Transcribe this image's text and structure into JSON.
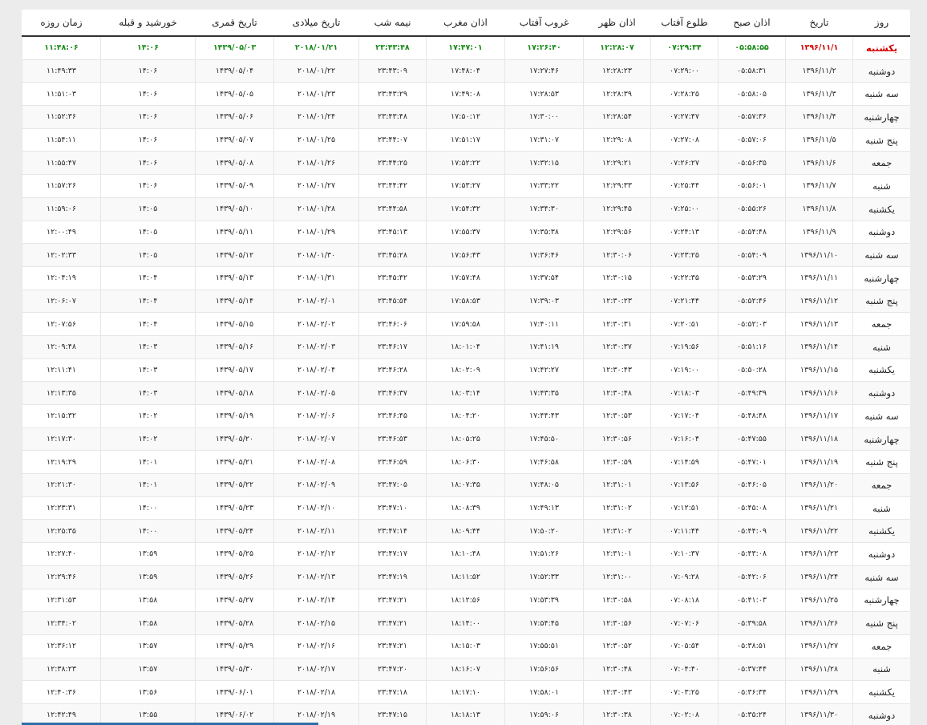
{
  "colors": {
    "today_green": "#1a8a1a",
    "today_red": "#d60000",
    "header_rule": "#333333",
    "scrollbar": "#2e6ea6"
  },
  "table": {
    "columns": [
      {
        "key": "day",
        "label": "روز"
      },
      {
        "key": "date",
        "label": "تاریخ"
      },
      {
        "key": "fajr",
        "label": "اذان صبح"
      },
      {
        "key": "sunrise",
        "label": "طلوع آفتاب"
      },
      {
        "key": "dhuhr",
        "label": "اذان ظهر"
      },
      {
        "key": "sunset",
        "label": "غروب آفتاب"
      },
      {
        "key": "maghrib",
        "label": "اذان مغرب"
      },
      {
        "key": "midnight",
        "label": "نیمه شب"
      },
      {
        "key": "gregorian",
        "label": "تاریخ میلادی"
      },
      {
        "key": "hijri",
        "label": "تاریخ قمری"
      },
      {
        "key": "qibla",
        "label": "خورشید و قبله"
      },
      {
        "key": "fast",
        "label": "زمان روزه"
      }
    ],
    "today_index": 0,
    "rows": [
      [
        "یکشنبه",
        "۱۳۹۶/۱۱/۱",
        "۰۵:۵۸:۵۵",
        "۰۷:۲۹:۳۴",
        "۱۲:۲۸:۰۷",
        "۱۷:۲۶:۴۰",
        "۱۷:۴۷:۰۱",
        "۲۳:۴۳:۴۸",
        "۲۰۱۸/۰۱/۲۱",
        "۱۴۳۹/۰۵/۰۳",
        "۱۴:۰۶",
        "۱۱:۴۸:۰۶"
      ],
      [
        "دوشنبه",
        "۱۳۹۶/۱۱/۲",
        "۰۵:۵۸:۳۱",
        "۰۷:۲۹:۰۰",
        "۱۲:۲۸:۲۳",
        "۱۷:۲۷:۴۶",
        "۱۷:۴۸:۰۴",
        "۲۳:۴۳:۰۹",
        "۲۰۱۸/۰۱/۲۲",
        "۱۴۳۹/۰۵/۰۴",
        "۱۴:۰۶",
        "۱۱:۴۹:۳۳"
      ],
      [
        "سه شنبه",
        "۱۳۹۶/۱۱/۳",
        "۰۵:۵۸:۰۵",
        "۰۷:۲۸:۲۵",
        "۱۲:۲۸:۳۹",
        "۱۷:۲۸:۵۳",
        "۱۷:۴۹:۰۸",
        "۲۳:۴۳:۲۹",
        "۲۰۱۸/۰۱/۲۳",
        "۱۴۳۹/۰۵/۰۵",
        "۱۴:۰۶",
        "۱۱:۵۱:۰۳"
      ],
      [
        "چهارشنبه",
        "۱۳۹۶/۱۱/۴",
        "۰۵:۵۷:۳۶",
        "۰۷:۲۷:۴۷",
        "۱۲:۲۸:۵۴",
        "۱۷:۳۰:۰۰",
        "۱۷:۵۰:۱۲",
        "۲۳:۴۳:۴۸",
        "۲۰۱۸/۰۱/۲۴",
        "۱۴۳۹/۰۵/۰۶",
        "۱۴:۰۶",
        "۱۱:۵۲:۳۶"
      ],
      [
        "پنج شنبه",
        "۱۳۹۶/۱۱/۵",
        "۰۵:۵۷:۰۶",
        "۰۷:۲۷:۰۸",
        "۱۲:۲۹:۰۸",
        "۱۷:۳۱:۰۷",
        "۱۷:۵۱:۱۷",
        "۲۳:۴۴:۰۷",
        "۲۰۱۸/۰۱/۲۵",
        "۱۴۳۹/۰۵/۰۷",
        "۱۴:۰۶",
        "۱۱:۵۴:۱۱"
      ],
      [
        "جمعه",
        "۱۳۹۶/۱۱/۶",
        "۰۵:۵۶:۳۵",
        "۰۷:۲۶:۲۷",
        "۱۲:۲۹:۲۱",
        "۱۷:۳۲:۱۵",
        "۱۷:۵۲:۲۲",
        "۲۳:۴۴:۲۵",
        "۲۰۱۸/۰۱/۲۶",
        "۱۴۳۹/۰۵/۰۸",
        "۱۴:۰۶",
        "۱۱:۵۵:۴۷"
      ],
      [
        "شنبه",
        "۱۳۹۶/۱۱/۷",
        "۰۵:۵۶:۰۱",
        "۰۷:۲۵:۴۴",
        "۱۲:۲۹:۳۳",
        "۱۷:۳۳:۲۲",
        "۱۷:۵۳:۲۷",
        "۲۳:۴۴:۴۲",
        "۲۰۱۸/۰۱/۲۷",
        "۱۴۳۹/۰۵/۰۹",
        "۱۴:۰۶",
        "۱۱:۵۷:۲۶"
      ],
      [
        "یکشنبه",
        "۱۳۹۶/۱۱/۸",
        "۰۵:۵۵:۲۶",
        "۰۷:۲۵:۰۰",
        "۱۲:۲۹:۴۵",
        "۱۷:۳۴:۳۰",
        "۱۷:۵۴:۳۲",
        "۲۳:۴۴:۵۸",
        "۲۰۱۸/۰۱/۲۸",
        "۱۴۳۹/۰۵/۱۰",
        "۱۴:۰۵",
        "۱۱:۵۹:۰۶"
      ],
      [
        "دوشنبه",
        "۱۳۹۶/۱۱/۹",
        "۰۵:۵۴:۴۸",
        "۰۷:۲۴:۱۳",
        "۱۲:۲۹:۵۶",
        "۱۷:۳۵:۳۸",
        "۱۷:۵۵:۳۷",
        "۲۳:۴۵:۱۳",
        "۲۰۱۸/۰۱/۲۹",
        "۱۴۳۹/۰۵/۱۱",
        "۱۴:۰۵",
        "۱۲:۰۰:۴۹"
      ],
      [
        "سه شنبه",
        "۱۳۹۶/۱۱/۱۰",
        "۰۵:۵۴:۰۹",
        "۰۷:۲۳:۲۵",
        "۱۲:۳۰:۰۶",
        "۱۷:۳۶:۴۶",
        "۱۷:۵۶:۴۳",
        "۲۳:۴۵:۲۸",
        "۲۰۱۸/۰۱/۳۰",
        "۱۴۳۹/۰۵/۱۲",
        "۱۴:۰۵",
        "۱۲:۰۲:۳۳"
      ],
      [
        "چهارشنبه",
        "۱۳۹۶/۱۱/۱۱",
        "۰۵:۵۳:۲۹",
        "۰۷:۲۲:۳۵",
        "۱۲:۳۰:۱۵",
        "۱۷:۳۷:۵۴",
        "۱۷:۵۷:۴۸",
        "۲۳:۴۵:۴۲",
        "۲۰۱۸/۰۱/۳۱",
        "۱۴۳۹/۰۵/۱۳",
        "۱۴:۰۴",
        "۱۲:۰۴:۱۹"
      ],
      [
        "پنج شنبه",
        "۱۳۹۶/۱۱/۱۲",
        "۰۵:۵۲:۴۶",
        "۰۷:۲۱:۴۴",
        "۱۲:۳۰:۲۳",
        "۱۷:۳۹:۰۳",
        "۱۷:۵۸:۵۳",
        "۲۳:۴۵:۵۴",
        "۲۰۱۸/۰۲/۰۱",
        "۱۴۳۹/۰۵/۱۴",
        "۱۴:۰۴",
        "۱۲:۰۶:۰۷"
      ],
      [
        "جمعه",
        "۱۳۹۶/۱۱/۱۳",
        "۰۵:۵۲:۰۳",
        "۰۷:۲۰:۵۱",
        "۱۲:۳۰:۳۱",
        "۱۷:۴۰:۱۱",
        "۱۷:۵۹:۵۸",
        "۲۳:۴۶:۰۶",
        "۲۰۱۸/۰۲/۰۲",
        "۱۴۳۹/۰۵/۱۵",
        "۱۴:۰۴",
        "۱۲:۰۷:۵۶"
      ],
      [
        "شنبه",
        "۱۳۹۶/۱۱/۱۴",
        "۰۵:۵۱:۱۶",
        "۰۷:۱۹:۵۶",
        "۱۲:۳۰:۳۷",
        "۱۷:۴۱:۱۹",
        "۱۸:۰۱:۰۴",
        "۲۳:۴۶:۱۷",
        "۲۰۱۸/۰۲/۰۳",
        "۱۴۳۹/۰۵/۱۶",
        "۱۴:۰۳",
        "۱۲:۰۹:۴۸"
      ],
      [
        "یکشنبه",
        "۱۳۹۶/۱۱/۱۵",
        "۰۵:۵۰:۲۸",
        "۰۷:۱۹:۰۰",
        "۱۲:۳۰:۴۳",
        "۱۷:۴۲:۲۷",
        "۱۸:۰۲:۰۹",
        "۲۳:۴۶:۲۸",
        "۲۰۱۸/۰۲/۰۴",
        "۱۴۳۹/۰۵/۱۷",
        "۱۴:۰۳",
        "۱۲:۱۱:۴۱"
      ],
      [
        "دوشنبه",
        "۱۳۹۶/۱۱/۱۶",
        "۰۵:۴۹:۳۹",
        "۰۷:۱۸:۰۳",
        "۱۲:۳۰:۴۸",
        "۱۷:۴۳:۳۵",
        "۱۸:۰۳:۱۴",
        "۲۳:۴۶:۳۷",
        "۲۰۱۸/۰۲/۰۵",
        "۱۴۳۹/۰۵/۱۸",
        "۱۴:۰۳",
        "۱۲:۱۳:۳۵"
      ],
      [
        "سه شنبه",
        "۱۳۹۶/۱۱/۱۷",
        "۰۵:۴۸:۴۸",
        "۰۷:۱۷:۰۴",
        "۱۲:۳۰:۵۳",
        "۱۷:۴۴:۴۳",
        "۱۸:۰۴:۲۰",
        "۲۳:۴۶:۴۵",
        "۲۰۱۸/۰۲/۰۶",
        "۱۴۳۹/۰۵/۱۹",
        "۱۴:۰۲",
        "۱۲:۱۵:۳۲"
      ],
      [
        "چهارشنبه",
        "۱۳۹۶/۱۱/۱۸",
        "۰۵:۴۷:۵۵",
        "۰۷:۱۶:۰۴",
        "۱۲:۳۰:۵۶",
        "۱۷:۴۵:۵۰",
        "۱۸:۰۵:۲۵",
        "۲۳:۴۶:۵۳",
        "۲۰۱۸/۰۲/۰۷",
        "۱۴۳۹/۰۵/۲۰",
        "۱۴:۰۲",
        "۱۲:۱۷:۳۰"
      ],
      [
        "پنج شنبه",
        "۱۳۹۶/۱۱/۱۹",
        "۰۵:۴۷:۰۱",
        "۰۷:۱۴:۵۹",
        "۱۲:۳۰:۵۹",
        "۱۷:۴۶:۵۸",
        "۱۸:۰۶:۳۰",
        "۲۳:۴۶:۵۹",
        "۲۰۱۸/۰۲/۰۸",
        "۱۴۳۹/۰۵/۲۱",
        "۱۴:۰۱",
        "۱۲:۱۹:۲۹"
      ],
      [
        "جمعه",
        "۱۳۹۶/۱۱/۲۰",
        "۰۵:۴۶:۰۵",
        "۰۷:۱۳:۵۶",
        "۱۲:۳۱:۰۱",
        "۱۷:۴۸:۰۵",
        "۱۸:۰۷:۳۵",
        "۲۳:۴۷:۰۵",
        "۲۰۱۸/۰۲/۰۹",
        "۱۴۳۹/۰۵/۲۲",
        "۱۴:۰۱",
        "۱۲:۲۱:۳۰"
      ],
      [
        "شنبه",
        "۱۳۹۶/۱۱/۲۱",
        "۰۵:۴۵:۰۸",
        "۰۷:۱۲:۵۱",
        "۱۲:۳۱:۰۲",
        "۱۷:۴۹:۱۳",
        "۱۸:۰۸:۳۹",
        "۲۳:۴۷:۱۰",
        "۲۰۱۸/۰۲/۱۰",
        "۱۴۳۹/۰۵/۲۳",
        "۱۴:۰۰",
        "۱۲:۲۳:۳۱"
      ],
      [
        "یکشنبه",
        "۱۳۹۶/۱۱/۲۲",
        "۰۵:۴۴:۰۹",
        "۰۷:۱۱:۴۴",
        "۱۲:۳۱:۰۲",
        "۱۷:۵۰:۲۰",
        "۱۸:۰۹:۴۴",
        "۲۳:۴۷:۱۴",
        "۲۰۱۸/۰۲/۱۱",
        "۱۴۳۹/۰۵/۲۴",
        "۱۴:۰۰",
        "۱۲:۲۵:۳۵"
      ],
      [
        "دوشنبه",
        "۱۳۹۶/۱۱/۲۳",
        "۰۵:۴۳:۰۸",
        "۰۷:۱۰:۳۷",
        "۱۲:۳۱:۰۱",
        "۱۷:۵۱:۲۶",
        "۱۸:۱۰:۴۸",
        "۲۳:۴۷:۱۷",
        "۲۰۱۸/۰۲/۱۲",
        "۱۴۳۹/۰۵/۲۵",
        "۱۳:۵۹",
        "۱۲:۲۷:۴۰"
      ],
      [
        "سه شنبه",
        "۱۳۹۶/۱۱/۲۴",
        "۰۵:۴۲:۰۶",
        "۰۷:۰۹:۲۸",
        "۱۲:۳۱:۰۰",
        "۱۷:۵۲:۳۳",
        "۱۸:۱۱:۵۲",
        "۲۳:۴۷:۱۹",
        "۲۰۱۸/۰۲/۱۳",
        "۱۴۳۹/۰۵/۲۶",
        "۱۳:۵۹",
        "۱۲:۲۹:۴۶"
      ],
      [
        "چهارشنبه",
        "۱۳۹۶/۱۱/۲۵",
        "۰۵:۴۱:۰۳",
        "۰۷:۰۸:۱۸",
        "۱۲:۳۰:۵۸",
        "۱۷:۵۳:۳۹",
        "۱۸:۱۲:۵۶",
        "۲۳:۴۷:۲۱",
        "۲۰۱۸/۰۲/۱۴",
        "۱۴۳۹/۰۵/۲۷",
        "۱۳:۵۸",
        "۱۲:۳۱:۵۳"
      ],
      [
        "پنج شنبه",
        "۱۳۹۶/۱۱/۲۶",
        "۰۵:۳۹:۵۸",
        "۰۷:۰۷:۰۶",
        "۱۲:۳۰:۵۶",
        "۱۷:۵۴:۴۵",
        "۱۸:۱۴:۰۰",
        "۲۳:۴۷:۲۱",
        "۲۰۱۸/۰۲/۱۵",
        "۱۴۳۹/۰۵/۲۸",
        "۱۳:۵۸",
        "۱۲:۳۴:۰۲"
      ],
      [
        "جمعه",
        "۱۳۹۶/۱۱/۲۷",
        "۰۵:۳۸:۵۱",
        "۰۷:۰۵:۵۴",
        "۱۲:۳۰:۵۲",
        "۱۷:۵۵:۵۱",
        "۱۸:۱۵:۰۳",
        "۲۳:۴۷:۲۱",
        "۲۰۱۸/۰۲/۱۶",
        "۱۴۳۹/۰۵/۲۹",
        "۱۳:۵۷",
        "۱۲:۳۶:۱۲"
      ],
      [
        "شنبه",
        "۱۳۹۶/۱۱/۲۸",
        "۰۵:۳۷:۴۴",
        "۰۷:۰۴:۴۰",
        "۱۲:۳۰:۴۸",
        "۱۷:۵۶:۵۶",
        "۱۸:۱۶:۰۷",
        "۲۳:۴۷:۲۰",
        "۲۰۱۸/۰۲/۱۷",
        "۱۴۳۹/۰۵/۳۰",
        "۱۳:۵۷",
        "۱۲:۳۸:۲۳"
      ],
      [
        "یکشنبه",
        "۱۳۹۶/۱۱/۲۹",
        "۰۵:۳۶:۳۴",
        "۰۷:۰۳:۲۵",
        "۱۲:۳۰:۴۳",
        "۱۷:۵۸:۰۱",
        "۱۸:۱۷:۱۰",
        "۲۳:۴۷:۱۸",
        "۲۰۱۸/۰۲/۱۸",
        "۱۴۳۹/۰۶/۰۱",
        "۱۳:۵۶",
        "۱۲:۴۰:۳۶"
      ],
      [
        "دوشنبه",
        "۱۳۹۶/۱۱/۳۰",
        "۰۵:۳۵:۲۴",
        "۰۷:۰۲:۰۸",
        "۱۲:۳۰:۳۸",
        "۱۷:۵۹:۰۶",
        "۱۸:۱۸:۱۳",
        "۲۳:۴۷:۱۵",
        "۲۰۱۸/۰۲/۱۹",
        "۱۴۳۹/۰۶/۰۲",
        "۱۳:۵۵",
        "۱۲:۴۲:۴۹"
      ]
    ]
  }
}
